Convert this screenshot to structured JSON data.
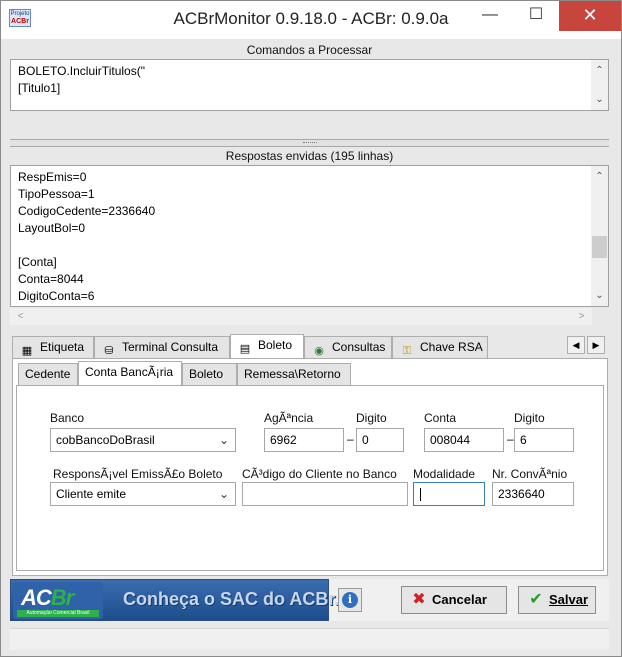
{
  "window": {
    "icon_text_top": "Projeto",
    "icon_text_bottom": "ACBr",
    "title": "ACBrMonitor 0.9.18.0 - ACBr: 0.9.0a"
  },
  "commands": {
    "header": "Comandos a Processar",
    "lines": [
      "BOLETO.IncluirTitulos(\"",
      "[Titulo1]"
    ]
  },
  "responses": {
    "header": "Respostas envidas (195 linhas)",
    "lines": [
      "RespEmis=0",
      "TipoPessoa=1",
      "CodigoCedente=2336640",
      "LayoutBol=0",
      "",
      "[Conta]",
      "Conta=8044",
      "DigitoConta=6"
    ]
  },
  "main_tabs": [
    {
      "label": "Etiqueta",
      "icon": "barcode-icon"
    },
    {
      "label": "Terminal Consulta",
      "icon": "database-icon"
    },
    {
      "label": "Boleto",
      "icon": "boleto-icon"
    },
    {
      "label": "Consultas",
      "icon": "globe-icon"
    },
    {
      "label": "Chave RSA",
      "icon": "key-icon"
    }
  ],
  "sub_tabs": [
    "Cedente",
    "Conta BancÃ¡ria",
    "Boleto",
    "Remessa\\Retorno"
  ],
  "form": {
    "banco_label": "Banco",
    "banco_value": "cobBancoDoBrasil",
    "agencia_label": "AgÃªncia",
    "agencia_value": "6962",
    "agencia_digito_label": "Digito",
    "agencia_digito_value": "0",
    "conta_label": "Conta",
    "conta_value": "008044",
    "conta_digito_label": "Digito",
    "conta_digito_value": "6",
    "separator": "–",
    "resp_emissao_label": "ResponsÃ¡vel EmissÃ£o Boleto",
    "resp_emissao_value": "Cliente emite",
    "codigo_cliente_label": "CÃ³digo do Cliente no Banco",
    "codigo_cliente_value": "",
    "modalidade_label": "Modalidade",
    "modalidade_value": "",
    "convenio_label": "Nr. ConvÃªnio",
    "convenio_value": "2336640"
  },
  "footer": {
    "logo_text_a": "AC",
    "logo_text_b": "Br",
    "logo_sub": "Automação Comercial Brasil",
    "banner_text": "Conheça o SAC do ACBr.",
    "info_glyph": "i",
    "cancel_label": "Cancelar",
    "save_label": "Salvar"
  },
  "colors": {
    "banner": "#1c4d8c",
    "close_button": "#c7453c",
    "accent": "#3c7fb1"
  }
}
